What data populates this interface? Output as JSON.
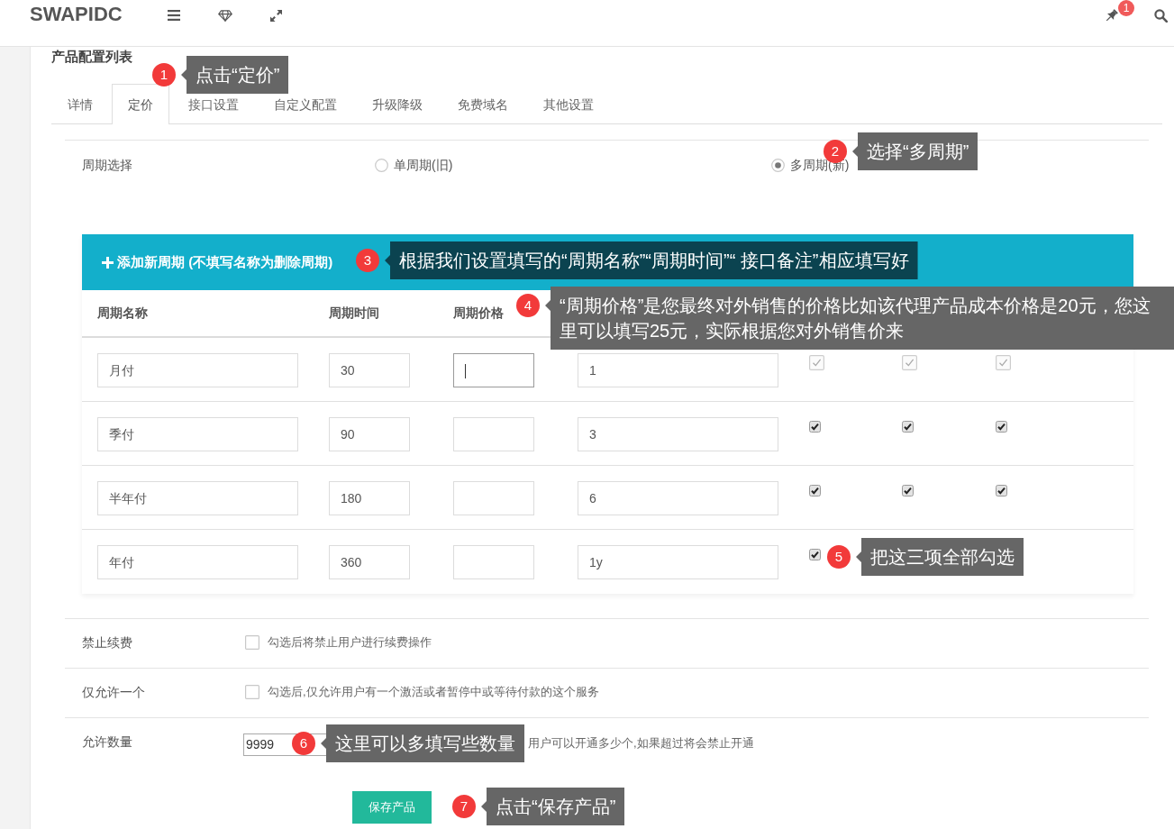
{
  "header": {
    "logo": "SWAPIDC",
    "notification_count": "1"
  },
  "page_title": "产品配置列表",
  "tabs": [
    {
      "label": "详情",
      "selected": false
    },
    {
      "label": "定价",
      "selected": true
    },
    {
      "label": "接口设置",
      "selected": false
    },
    {
      "label": "自定义配置",
      "selected": false
    },
    {
      "label": "升级降级",
      "selected": false
    },
    {
      "label": "免费域名",
      "selected": false
    },
    {
      "label": "其他设置",
      "selected": false
    }
  ],
  "cycle_mode": {
    "label": "周期选择",
    "options": [
      {
        "label": "单周期(旧)",
        "selected": false
      },
      {
        "label": "多周期(新)",
        "selected": true
      }
    ]
  },
  "cycles": {
    "add_label": "添加新周期 (不填写名称为删除周期)",
    "columns": [
      "周期名称",
      "周期时间",
      "周期价格"
    ],
    "rows": [
      {
        "name": "月付",
        "time": "30",
        "price_focused": true,
        "note": "1",
        "checks": [
          {
            "checked": true,
            "disabled": true
          },
          {
            "checked": true,
            "disabled": true
          },
          {
            "checked": true,
            "disabled": true
          }
        ]
      },
      {
        "name": "季付",
        "time": "90",
        "price_focused": false,
        "note": "3",
        "checks": [
          {
            "checked": true,
            "disabled": false
          },
          {
            "checked": true,
            "disabled": false
          },
          {
            "checked": true,
            "disabled": false
          }
        ]
      },
      {
        "name": "半年付",
        "time": "180",
        "price_focused": false,
        "note": "6",
        "checks": [
          {
            "checked": true,
            "disabled": false
          },
          {
            "checked": true,
            "disabled": false
          },
          {
            "checked": true,
            "disabled": false
          }
        ]
      },
      {
        "name": "年付",
        "time": "360",
        "price_focused": false,
        "note": "1y",
        "checks": [
          {
            "checked": true,
            "disabled": false
          }
        ]
      }
    ]
  },
  "settings": [
    {
      "kind": "checkbox",
      "label": "禁止续费",
      "checked": false,
      "hint": "勾选后将禁止用户进行续费操作"
    },
    {
      "kind": "checkbox",
      "label": "仅允许一个",
      "checked": false,
      "hint": "勾选后,仅允许用户有一个激活或者暂停中或等待付款的这个服务"
    },
    {
      "kind": "number",
      "label": "允许数量",
      "value": "9999",
      "hint": "用户可以开通多少个,如果超过将会禁止开通"
    }
  ],
  "save_button": "保存产品",
  "annotations": [
    {
      "number": "1",
      "text": "点击“定价”",
      "color": "#666666"
    },
    {
      "number": "2",
      "text": "选择“多周期”",
      "color": "#666666"
    },
    {
      "number": "3",
      "text": "根据我们设置填写的“周期名称”“周期时间”“ 接口备注”相应填写好",
      "color": "#0b4350"
    },
    {
      "number": "4",
      "text": "“周期价格”是您最终对外销售的价格比如该代理产品成本价格是20元，您这里可以填写25元，实际根据您对外销售价来",
      "color": "#666666"
    },
    {
      "number": "5",
      "text": "把这三项全部勾选",
      "color": "#666666"
    },
    {
      "number": "6",
      "text": "这里可以多填写些数量",
      "color": "#666666"
    },
    {
      "number": "7",
      "text": "点击“保存产品”",
      "color": "#666666"
    }
  ]
}
